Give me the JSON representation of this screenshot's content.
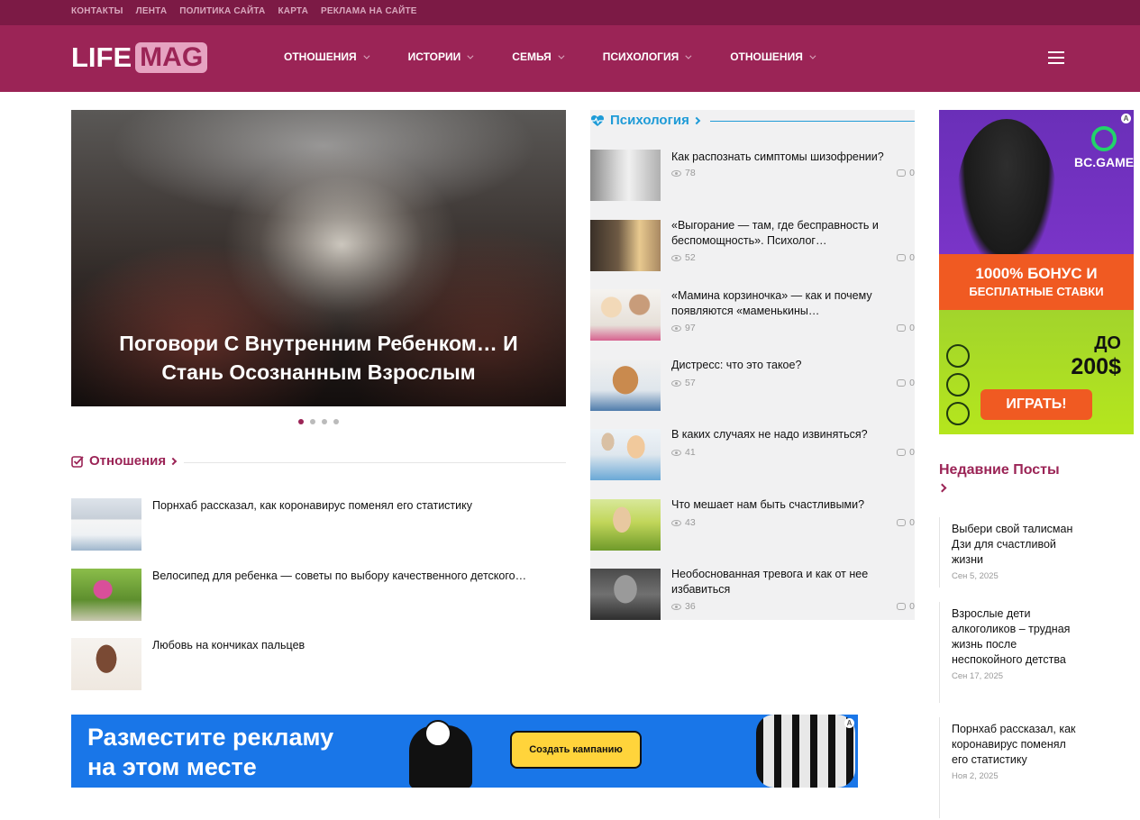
{
  "topbar": {
    "links": [
      "КОНТАКТЫ",
      "ЛЕНТА",
      "ПОЛИТИКА САЙТА",
      "КАРТА",
      "РЕКЛАМА НА САЙТЕ"
    ]
  },
  "header": {
    "logo_left": "LIFE",
    "logo_right": "MAG",
    "nav": [
      "ОТНОШЕНИЯ",
      "ИСТОРИИ",
      "СЕМЬЯ",
      "ПСИХОЛОГИЯ",
      "ОТНОШЕНИЯ"
    ],
    "menu_icon": "hamburger-icon"
  },
  "slider": {
    "caption_line1": "Поговори С Внутренним Ребенком… И",
    "caption_line2": "Стань Осознанным Взрослым",
    "dots_count": 4,
    "active_dot": 1
  },
  "relations": {
    "title": "Отношения",
    "items": [
      {
        "title": "Порнхаб рассказал, как коронавирус поменял его статистику"
      },
      {
        "title": "Велосипед для ребенка — советы по выбору качественного детского…"
      },
      {
        "title": "Любовь на кончиках пальцев"
      }
    ]
  },
  "psychology": {
    "title": "Психология",
    "items": [
      {
        "title_line1": "Как распознать симптомы шизофрении?",
        "title_line2": "",
        "views": "78",
        "comments": "0"
      },
      {
        "title_line1": "«Выгорание — там, где бесправность и",
        "title_line2": "беспомощность». Психолог…",
        "views": "52",
        "comments": "0"
      },
      {
        "title_line1": "«Мамина корзиночка» — как и почему",
        "title_line2": "появляются «маменькины…",
        "views": "97",
        "comments": "0"
      },
      {
        "title_line1": "Дистресс: что это такое?",
        "title_line2": "",
        "views": "57",
        "comments": "0"
      },
      {
        "title_line1": "В каких случаях не надо извиняться?",
        "title_line2": "",
        "views": "41",
        "comments": "0"
      },
      {
        "title_line1": "Что мешает нам быть счастливыми?",
        "title_line2": "",
        "views": "43",
        "comments": "0"
      },
      {
        "title_line1": "Необоснованная тревога и как от нее",
        "title_line2": "избавиться",
        "views": "36",
        "comments": "0"
      }
    ]
  },
  "ad_side": {
    "brand": "BC.GAME",
    "bonus_line1": "1000% БОНУС И",
    "bonus_line2": "БЕСПЛАТНЫЕ СТАВКИ",
    "amount_line1": "ДО",
    "amount_line2": "200$",
    "cta": "ИГРАТЬ!",
    "badge": "A"
  },
  "ad_banner": {
    "line1": "Разместите рекламу",
    "line2": "на этом месте",
    "cta": "Создать кампанию",
    "badge": "A"
  },
  "recent": {
    "title": "Недавние Посты",
    "items": [
      {
        "title": "Выбери свой талисман Дзи для счастливой жизни",
        "date": "Сен 5, 2025"
      },
      {
        "title": "Взрослые дети алкоголиков – трудная жизнь после неспокойного детства",
        "date": "Сен 17, 2025"
      },
      {
        "title": "Порнхаб рассказал, как коронавирус поменял его статистику",
        "date": "Ноя 2, 2025"
      }
    ]
  },
  "colors": {
    "topbar": "#7c1a45",
    "header": "#9b2456",
    "accent_relations": "#9b2456",
    "accent_psychology": "#1e9bd7"
  }
}
